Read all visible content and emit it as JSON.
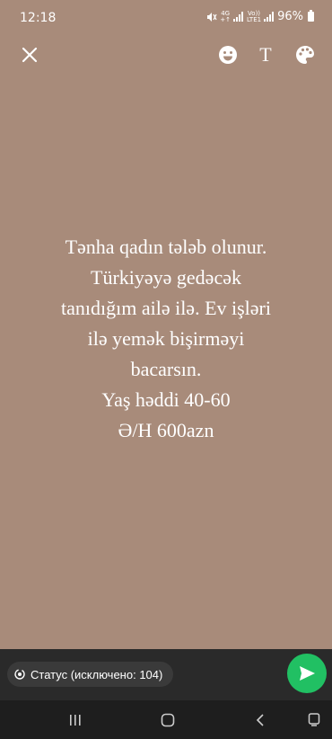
{
  "status_bar": {
    "time": "12:18",
    "network_top": "4G",
    "network_bottom": "+↑",
    "volte_top": "Vo))",
    "volte_bottom": "LTE1",
    "battery": "96%"
  },
  "toolbar": {
    "close_icon": "close-icon",
    "emoji_icon": "emoji-icon",
    "text_label": "T",
    "palette_icon": "palette-icon"
  },
  "status_message": {
    "lines": [
      "Tənha qadın tələb olunur.",
      "Türkiyəyə gedəcək",
      "tanıdığım ailə ilə. Ev işləri",
      "ilə yemək bişirməyi",
      "bacarsın.",
      "Yaş həddi 40-60",
      "Ə/H 600azn"
    ]
  },
  "bottom_bar": {
    "audience_label": "Статус (исключено: 104)",
    "send_icon": "send-icon"
  },
  "nav_bar": {
    "recents_icon": "recents-icon",
    "home_icon": "home-icon",
    "back_icon": "back-icon",
    "keyboard_icon": "keyboard-icon"
  },
  "colors": {
    "background": "#a88b7a",
    "accent": "#21c063",
    "bottom_bar": "#2a2a2a"
  }
}
